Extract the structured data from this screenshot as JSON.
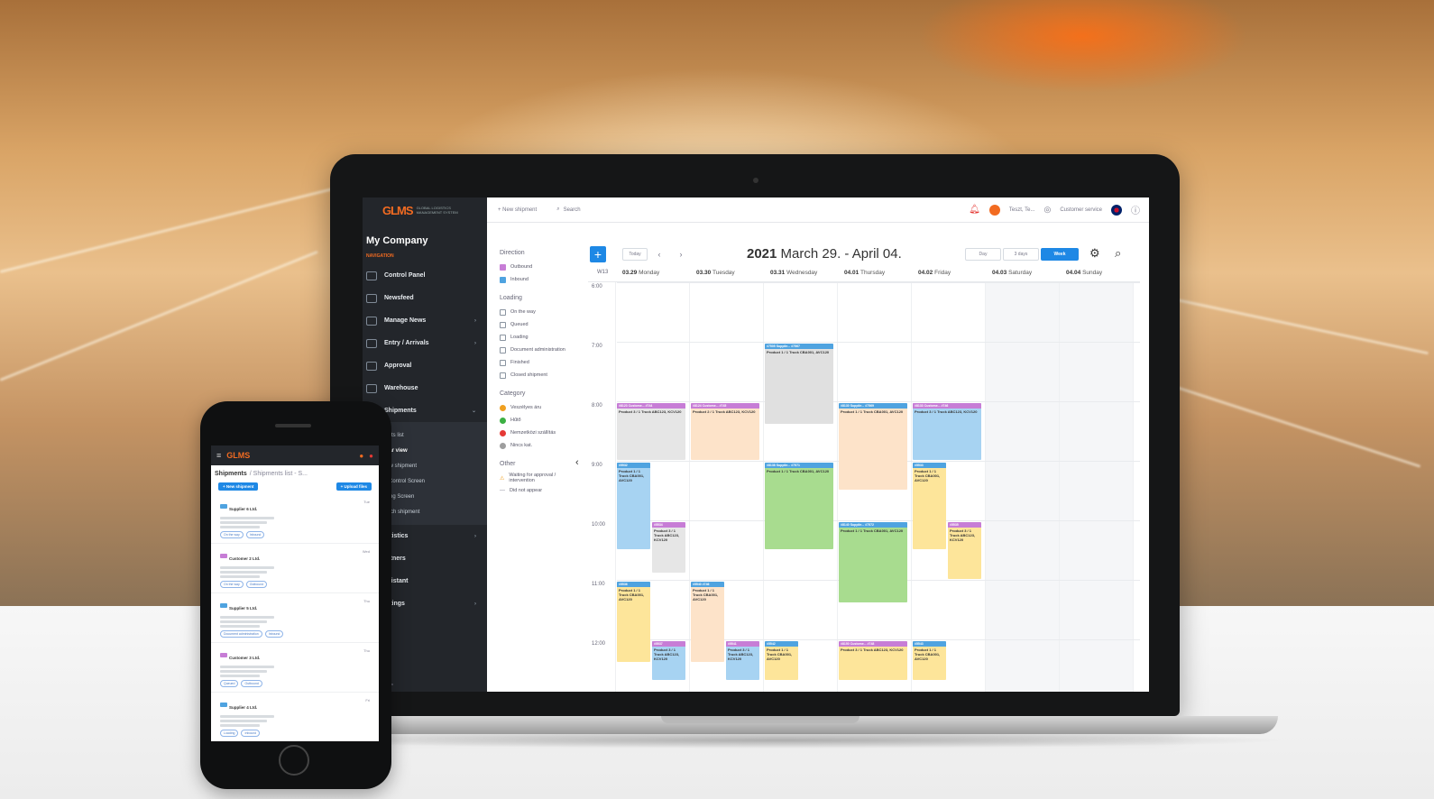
{
  "colors": {
    "accent": "#1e88e5",
    "brand": "#f26b21",
    "sidebar": "#23262b"
  },
  "sidebar": {
    "company": "My Company",
    "nav_header": "NAVIGATION",
    "items": [
      {
        "label": "Control Panel",
        "icon": "dashboard-icon"
      },
      {
        "label": "Newsfeed",
        "icon": "newsfeed-icon"
      },
      {
        "label": "Manage News",
        "icon": "news-icon",
        "expand": "›"
      },
      {
        "label": "Entry / Arrivals",
        "icon": "entry-icon",
        "expand": "›"
      },
      {
        "label": "Approval",
        "icon": "approval-icon"
      },
      {
        "label": "Warehouse",
        "icon": "warehouse-icon"
      },
      {
        "label": "Shipments",
        "icon": "shipments-icon",
        "expand": "⌄"
      }
    ],
    "subitems": [
      "nents list",
      "ndar view",
      "New shipment",
      "ar Control Screen",
      "ading Screen",
      "Batch shipment"
    ],
    "items2": [
      {
        "label": "tatistics",
        "expand": "›"
      },
      {
        "label": "artners"
      },
      {
        "label": "ssistant"
      },
      {
        "label": "ettings",
        "expand": "›"
      }
    ],
    "footer": "More information"
  },
  "topbar": {
    "new_shipment": "+ New shipment",
    "search": "Search",
    "user": "Teszt, Te...",
    "support": "Customer service"
  },
  "filters": {
    "direction": {
      "title": "Direction",
      "items": [
        "Outbound",
        "Inbound"
      ]
    },
    "loading": {
      "title": "Loading",
      "items": [
        "On the way",
        "Queued",
        "Loading",
        "Document administration",
        "Finished",
        "Closed shipment"
      ]
    },
    "category": {
      "title": "Category",
      "items": [
        {
          "label": "Veszélyes áru",
          "color": "#f0a020"
        },
        {
          "label": "Hűtő",
          "color": "#3cb043"
        },
        {
          "label": "Nemzetközi szállítás",
          "color": "#e53935"
        },
        {
          "label": "Nincs kat.",
          "color": "#9e9e9e"
        }
      ]
    },
    "other": {
      "title": "Other",
      "items": [
        "Waiting for approval / intervention",
        "Did not appear"
      ]
    }
  },
  "calendar": {
    "title_year": "2021",
    "title_range": "March 29. - April 04.",
    "today": "Today",
    "prev": "‹",
    "next": "›",
    "views": [
      "Day",
      "3 days",
      "Week"
    ],
    "week_label": "W13",
    "days": [
      {
        "date": "03.29",
        "name": "Monday"
      },
      {
        "date": "03.30",
        "name": "Tuesday"
      },
      {
        "date": "03.31",
        "name": "Wednesday"
      },
      {
        "date": "04.01",
        "name": "Thursday"
      },
      {
        "date": "04.02",
        "name": "Friday"
      },
      {
        "date": "04.03",
        "name": "Saturday"
      },
      {
        "date": "04.04",
        "name": "Sunday"
      }
    ],
    "hours": [
      "6:00",
      "7:00",
      "8:00",
      "9:00",
      "10:00",
      "11:00",
      "12:00"
    ],
    "events": [
      {
        "day": 2,
        "start": 7.0,
        "end": 8.4,
        "col": 0,
        "w": 1,
        "color": "#e0e0e0",
        "head": "#4fa3e0",
        "title": "#7505 Supplie... #7567",
        "body": "Product 1 / 1 Truck CBA001, AVC120"
      },
      {
        "day": 0,
        "start": 8.0,
        "end": 9.0,
        "col": 0,
        "w": 1,
        "color": "#e6e6e6",
        "head": "#c77dd6",
        "title": "#8123 Custome... #744",
        "body": "Product 3 / 1 Truck ABC123, KCV120"
      },
      {
        "day": 1,
        "start": 8.0,
        "end": 9.0,
        "col": 0,
        "w": 1,
        "color": "#fde3c9",
        "head": "#c77dd6",
        "title": "#8124 Custome... #745",
        "body": "Product 2 / 1 Truck ABC123, KCV120"
      },
      {
        "day": 3,
        "start": 8.0,
        "end": 9.5,
        "col": 0,
        "w": 1,
        "color": "#fde3c9",
        "head": "#4fa3e0",
        "title": "#8130 Supplie... #7569",
        "body": "Product 1 / 1 Truck CBA001, AVC120"
      },
      {
        "day": 4,
        "start": 8.0,
        "end": 9.0,
        "col": 0,
        "w": 1,
        "color": "#a7d3f2",
        "head": "#c77dd6",
        "title": "#8133 Custome... #746",
        "body": "Product 3 / 1 Truck ABC123, KCV120"
      },
      {
        "day": 0,
        "start": 9.0,
        "end": 10.5,
        "col": 0,
        "w": 0.5,
        "color": "#a7d3f2",
        "head": "#4fa3e0",
        "title": "#5532",
        "body": "Product 1 / 1 Truck CBA001, AVC120"
      },
      {
        "day": 2,
        "start": 9.0,
        "end": 10.5,
        "col": 0,
        "w": 1,
        "color": "#a8dc8f",
        "head": "#4fa3e0",
        "title": "#8138 Supplie... #7571",
        "body": "Product 1 / 1 Truck CBA001, AVC120"
      },
      {
        "day": 4,
        "start": 9.0,
        "end": 10.5,
        "col": 0,
        "w": 0.5,
        "color": "#fde59a",
        "head": "#4fa3e0",
        "title": "#5533",
        "body": "Product 1 / 1 Truck CBA001, AVC120"
      },
      {
        "day": 0,
        "start": 10.0,
        "end": 10.9,
        "col": 1,
        "w": 0.5,
        "color": "#e6e6e6",
        "head": "#c77dd6",
        "title": "#5534",
        "body": "Product 3 / 1 Truck ABC123, KCV120"
      },
      {
        "day": 3,
        "start": 10.0,
        "end": 11.4,
        "col": 0,
        "w": 1,
        "color": "#a8dc8f",
        "head": "#4fa3e0",
        "title": "#8140 Supplie... #7572",
        "body": "Product 1 / 1 Truck CBA001, AVC120"
      },
      {
        "day": 4,
        "start": 10.0,
        "end": 11.0,
        "col": 1,
        "w": 0.5,
        "color": "#fde59a",
        "head": "#c77dd6",
        "title": "#5535",
        "body": "Product 3 / 1 Truck ABC123, KCV120"
      },
      {
        "day": 0,
        "start": 11.0,
        "end": 12.4,
        "col": 0,
        "w": 0.5,
        "color": "#fde59a",
        "head": "#4fa3e0",
        "title": "#5536",
        "body": "Product 1 / 1 Truck CBA001, AVC120"
      },
      {
        "day": 1,
        "start": 11.0,
        "end": 12.4,
        "col": 0,
        "w": 0.5,
        "color": "#fde3c9",
        "head": "#4fa3e0",
        "title": "#5540 #746",
        "body": "Product 1 / 1 Truck CBA001, AVC120"
      },
      {
        "day": 0,
        "start": 12.0,
        "end": 12.7,
        "col": 1,
        "w": 0.5,
        "color": "#a7d3f2",
        "head": "#c77dd6",
        "title": "#5537",
        "body": "Product 3 / 1 Truck ABC123, KCV120"
      },
      {
        "day": 1,
        "start": 12.0,
        "end": 12.7,
        "col": 1,
        "w": 0.5,
        "color": "#a7d3f2",
        "head": "#c77dd6",
        "title": "#5541",
        "body": "Product 3 / 1 Truck ABC123, KCV120"
      },
      {
        "day": 2,
        "start": 12.0,
        "end": 12.7,
        "col": 0,
        "w": 0.5,
        "color": "#fde59a",
        "head": "#4fa3e0",
        "title": "#5542",
        "body": "Product 1 / 1 Truck CBA001, AVC120"
      },
      {
        "day": 3,
        "start": 12.0,
        "end": 12.7,
        "col": 0,
        "w": 1,
        "color": "#fde59a",
        "head": "#c77dd6",
        "title": "#8150 Custome... #748",
        "body": "Product 3 / 1 Truck ABC123, KCV120"
      },
      {
        "day": 4,
        "start": 12.0,
        "end": 12.7,
        "col": 0,
        "w": 0.5,
        "color": "#fde59a",
        "head": "#4fa3e0",
        "title": "#5543",
        "body": "Product 1 / 1 Truck CBA001, AVC120"
      }
    ]
  },
  "phone": {
    "title": "Shipments",
    "crumb": "/ Shipments list - S...",
    "new_btn": "+ New shipment",
    "upload_btn": "+ Upload files",
    "items": [
      {
        "name": "Supplier 6 Ltd.",
        "time": "Tue",
        "tag": "#4fa3e0",
        "badges": [
          "On the way",
          "Inbound"
        ]
      },
      {
        "name": "Customer 2 Ltd.",
        "time": "Wed",
        "tag": "#c77dd6",
        "badges": [
          "On the way",
          "Outbound"
        ]
      },
      {
        "name": "Supplier 5 Ltd.",
        "time": "Thu",
        "tag": "#4fa3e0",
        "badges": [
          "Document administration",
          "Inbound"
        ]
      },
      {
        "name": "Customer 3 Ltd.",
        "time": "Thu",
        "tag": "#c77dd6",
        "badges": [
          "Queued",
          "Outbound"
        ]
      },
      {
        "name": "Supplier 4 Ltd.",
        "time": "Fri",
        "tag": "#4fa3e0",
        "badges": [
          "Loading",
          "Inbound"
        ]
      }
    ]
  }
}
